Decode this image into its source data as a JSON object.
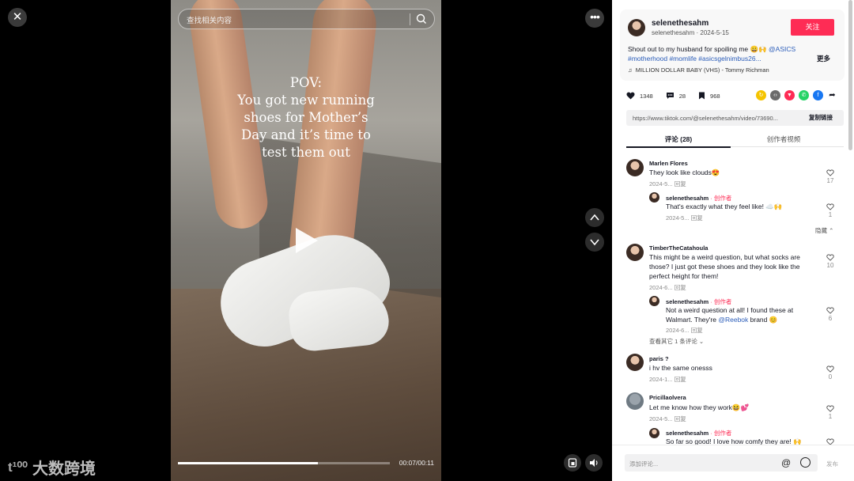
{
  "search": {
    "placeholder": "查找相关内容"
  },
  "video": {
    "overlay_lines": [
      "POV:",
      "You got new running",
      "shoes for Mother’s",
      "Day and it’s time to",
      "test them out"
    ],
    "time": "00:07/00:11",
    "progress": 0.66
  },
  "logo": {
    "text": "大数跨境",
    "mark": "t¹⁰⁰"
  },
  "post": {
    "author": "selenethesahm",
    "handle_date": "selenethesahm · 2024-5-15",
    "follow_label": "关注",
    "desc_plain": "Shout out to my husband for spoiling me 😀🙌 ",
    "desc_tags_1": "@ASICS",
    "desc_tags_2": "#motherhood #momlife #asicsgelnimbus26...",
    "more_label": "更多",
    "music": "MILLION DOLLAR BABY (VHS) - Tommy Richman",
    "likes": "1348",
    "comments": "28",
    "saves": "968",
    "link": "https://www.tiktok.com/@selenethesahm/video/73690...",
    "copy_label": "复制链接"
  },
  "tabs": {
    "comments": "评论 (28)",
    "creator": "创作者视频"
  },
  "comments": [
    {
      "name": "Marlen Flores",
      "text": "They look like clouds😍",
      "meta": "2024-5...  回复",
      "likes": "17"
    },
    {
      "name": "selenethesahm",
      "badge": " · 创作者",
      "text": "That's exactly what they feel like! ☁️🙌",
      "meta": "2024-5...  回复",
      "likes": "1"
    },
    {
      "collapse": "隐藏 ⌃"
    },
    {
      "name": "TimberTheCatahoula",
      "text_lines": [
        "This might be a weird question, but what socks are",
        "those? I just got these shoes and they look like the",
        "perfect height for them!"
      ],
      "meta": "2024-6...  回复",
      "likes": "10"
    },
    {
      "name": "selenethesahm",
      "badge": " · 创作者",
      "text_lines": [
        "Not a weird question at all! I found these at",
        "Walmart. They're "
      ],
      "mention": "@Reebok",
      "tail": " brand 😊",
      "meta": "2024-6...  回复",
      "likes": "6"
    },
    {
      "viewmore": "查看其它 1 条评论 ⌄"
    },
    {
      "name": "paris ?",
      "text": "i hv the same onesss",
      "meta": "2024-1...  回复",
      "likes": "0"
    },
    {
      "name": "Pricillaolvera",
      "text": "Let me know how they work😆💕",
      "meta": "2024-5...  回复",
      "likes": "1"
    },
    {
      "name": "selenethesahm",
      "badge": " · 创作者",
      "text": "So far so good! I love how comfy they are! 🙌",
      "likes": ""
    }
  ],
  "composer": {
    "placeholder": "添加评论...",
    "post_label": "发布"
  }
}
